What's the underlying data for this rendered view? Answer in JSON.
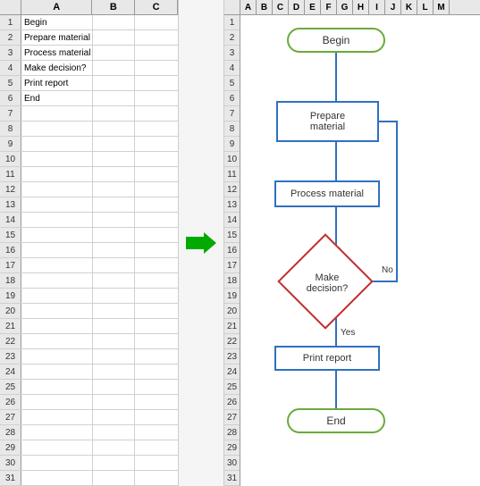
{
  "spreadsheet": {
    "columns": [
      "A",
      "B",
      "C"
    ],
    "rows": [
      {
        "num": 1,
        "a": "Begin",
        "b": "",
        "c": ""
      },
      {
        "num": 2,
        "a": "Prepare material",
        "b": "",
        "c": ""
      },
      {
        "num": 3,
        "a": "Process material",
        "b": "",
        "c": ""
      },
      {
        "num": 4,
        "a": "Make decision?",
        "b": "",
        "c": ""
      },
      {
        "num": 5,
        "a": "Print report",
        "b": "",
        "c": ""
      },
      {
        "num": 6,
        "a": "End",
        "b": "",
        "c": ""
      },
      {
        "num": 7,
        "a": "",
        "b": "",
        "c": ""
      },
      {
        "num": 8,
        "a": "",
        "b": "",
        "c": ""
      },
      {
        "num": 9,
        "a": "",
        "b": "",
        "c": ""
      },
      {
        "num": 10,
        "a": "",
        "b": "",
        "c": ""
      },
      {
        "num": 11,
        "a": "",
        "b": "",
        "c": ""
      },
      {
        "num": 12,
        "a": "",
        "b": "",
        "c": ""
      },
      {
        "num": 13,
        "a": "",
        "b": "",
        "c": ""
      },
      {
        "num": 14,
        "a": "",
        "b": "",
        "c": ""
      },
      {
        "num": 15,
        "a": "",
        "b": "",
        "c": ""
      },
      {
        "num": 16,
        "a": "",
        "b": "",
        "c": ""
      },
      {
        "num": 17,
        "a": "",
        "b": "",
        "c": ""
      },
      {
        "num": 18,
        "a": "",
        "b": "",
        "c": ""
      },
      {
        "num": 19,
        "a": "",
        "b": "",
        "c": ""
      },
      {
        "num": 20,
        "a": "",
        "b": "",
        "c": ""
      },
      {
        "num": 21,
        "a": "",
        "b": "",
        "c": ""
      },
      {
        "num": 22,
        "a": "",
        "b": "",
        "c": ""
      },
      {
        "num": 23,
        "a": "",
        "b": "",
        "c": ""
      },
      {
        "num": 24,
        "a": "",
        "b": "",
        "c": ""
      },
      {
        "num": 25,
        "a": "",
        "b": "",
        "c": ""
      },
      {
        "num": 26,
        "a": "",
        "b": "",
        "c": ""
      },
      {
        "num": 27,
        "a": "",
        "b": "",
        "c": ""
      },
      {
        "num": 28,
        "a": "",
        "b": "",
        "c": ""
      },
      {
        "num": 29,
        "a": "",
        "b": "",
        "c": ""
      },
      {
        "num": 30,
        "a": "",
        "b": "",
        "c": ""
      },
      {
        "num": 31,
        "a": "",
        "b": "",
        "c": ""
      }
    ]
  },
  "flowchart": {
    "columns": [
      "A",
      "B",
      "C",
      "D",
      "E",
      "F",
      "G",
      "H",
      "I",
      "J",
      "K",
      "L",
      "M"
    ],
    "rows_count": 31,
    "shapes": {
      "begin": {
        "label": "Begin",
        "type": "rounded"
      },
      "prepare": {
        "label": "Prepare\nmaterial",
        "type": "rect"
      },
      "process": {
        "label": "Process material",
        "type": "rect"
      },
      "decision": {
        "label": "Make\ndecision?",
        "type": "diamond"
      },
      "print": {
        "label": "Print report",
        "type": "rect"
      },
      "end": {
        "label": "End",
        "type": "rounded"
      }
    },
    "labels": {
      "yes": "Yes",
      "no": "No"
    }
  }
}
